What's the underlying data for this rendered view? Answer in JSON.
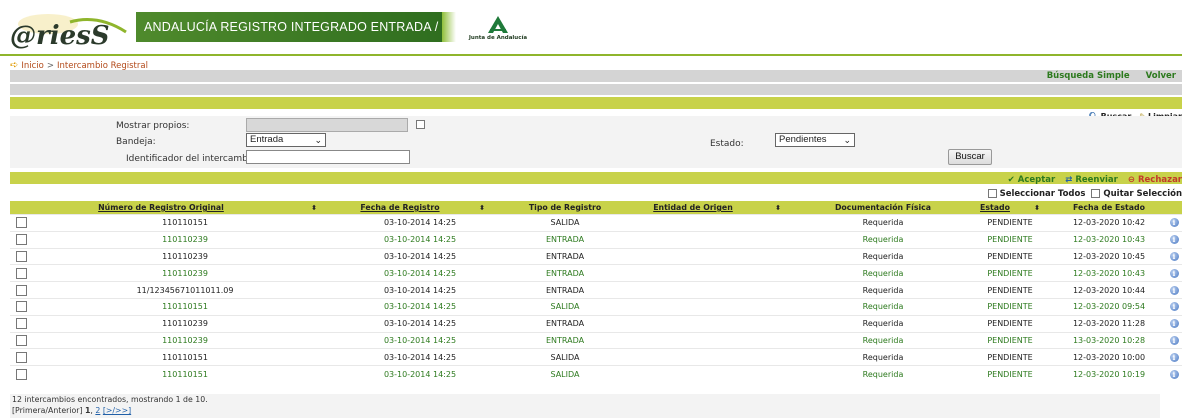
{
  "header": {
    "logo_text": "@riesS",
    "title": "ANDALUCÍA REGISTRO INTEGRADO ENTRADA / SALIDA",
    "junta_label": "Junta de Andalucía"
  },
  "breadcrumb": {
    "home": "Inicio",
    "sep": ">",
    "current": "Intercambio Registral"
  },
  "nav": {
    "simple_search": "Búsqueda Simple",
    "back": "Volver"
  },
  "search_actions": {
    "search": "Buscar",
    "clear": "Limpiar"
  },
  "filters": {
    "show_own_label": "Mostrar propios:",
    "tray_label": "Bandeja:",
    "tray_value": "Entrada",
    "exchange_id_label": "Identificador del intercambio:",
    "exchange_id_value": "",
    "status_label": "Estado:",
    "status_value": "Pendientes",
    "search_button": "Buscar"
  },
  "row_actions": {
    "accept": "Aceptar",
    "resend": "Reenviar",
    "reject": "Rechazar"
  },
  "selection": {
    "select_all": "Seleccionar Todos",
    "deselect": "Quitar Selección"
  },
  "table": {
    "columns": {
      "orig_number": "Número de Registro Original",
      "reg_date": "Fecha de Registro",
      "reg_type": "Tipo de Registro",
      "origin_entity": "Entidad de Origen",
      "physical_doc": "Documentación Física",
      "status": "Estado",
      "status_date": "Fecha de Estado"
    },
    "sort_glyph": "⬍",
    "rows": [
      {
        "num": "110110151",
        "date": "03-10-2014 14:25",
        "type": "SALIDA",
        "entity": "",
        "doc": "Requerida",
        "status": "PENDIENTE",
        "sdate": "12-03-2020 10:42"
      },
      {
        "num": "110110239",
        "date": "03-10-2014 14:25",
        "type": "ENTRADA",
        "entity": "",
        "doc": "Requerida",
        "status": "PENDIENTE",
        "sdate": "12-03-2020 10:43"
      },
      {
        "num": "110110239",
        "date": "03-10-2014 14:25",
        "type": "ENTRADA",
        "entity": "",
        "doc": "Requerida",
        "status": "PENDIENTE",
        "sdate": "12-03-2020 10:45"
      },
      {
        "num": "110110239",
        "date": "03-10-2014 14:25",
        "type": "ENTRADA",
        "entity": "",
        "doc": "Requerida",
        "status": "PENDIENTE",
        "sdate": "12-03-2020 10:43"
      },
      {
        "num": "11/12345671011011.09",
        "date": "03-10-2014 14:25",
        "type": "ENTRADA",
        "entity": "",
        "doc": "Requerida",
        "status": "PENDIENTE",
        "sdate": "12-03-2020 10:44"
      },
      {
        "num": "110110151",
        "date": "03-10-2014 14:25",
        "type": "SALIDA",
        "entity": "",
        "doc": "Requerida",
        "status": "PENDIENTE",
        "sdate": "12-03-2020 09:54"
      },
      {
        "num": "110110239",
        "date": "03-10-2014 14:25",
        "type": "ENTRADA",
        "entity": "",
        "doc": "Requerida",
        "status": "PENDIENTE",
        "sdate": "12-03-2020 11:28"
      },
      {
        "num": "110110239",
        "date": "03-10-2014 14:25",
        "type": "ENTRADA",
        "entity": "",
        "doc": "Requerida",
        "status": "PENDIENTE",
        "sdate": "13-03-2020 10:28"
      },
      {
        "num": "110110151",
        "date": "03-10-2014 14:25",
        "type": "SALIDA",
        "entity": "",
        "doc": "Requerida",
        "status": "PENDIENTE",
        "sdate": "12-03-2020 10:00"
      },
      {
        "num": "110110151",
        "date": "03-10-2014 14:25",
        "type": "SALIDA",
        "entity": "",
        "doc": "Requerida",
        "status": "PENDIENTE",
        "sdate": "12-03-2020 10:19"
      }
    ]
  },
  "footer": {
    "summary": "12 intercambios encontrados, mostrando 1 de 10.",
    "pager_prefix": "[Primera/Anterior]",
    "page_current": "1",
    "page_next": "2",
    "pager_suffix": "[>/>>]"
  },
  "colors": {
    "olive": "#c8d24a",
    "green": "#2d7a1e",
    "accent_red": "#c23a2a"
  }
}
